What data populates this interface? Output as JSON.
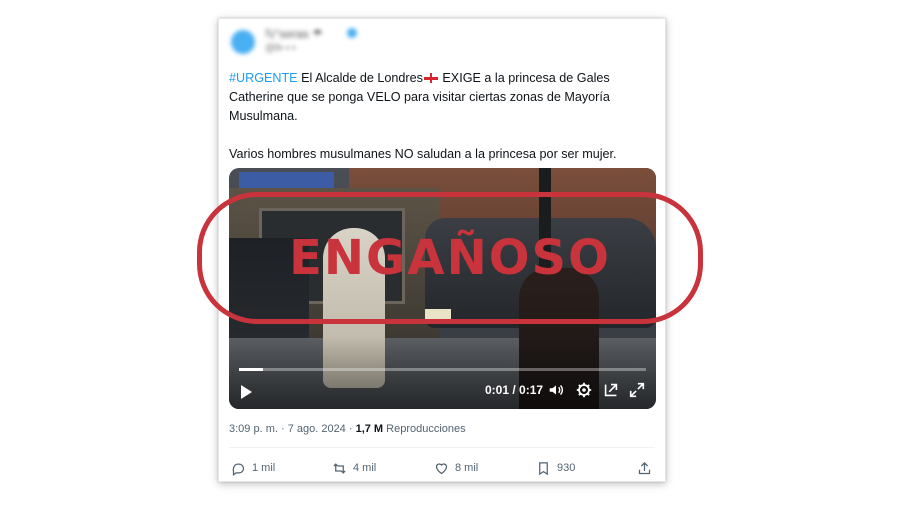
{
  "tweet": {
    "author_name": "ℕ°seras ☂",
    "author_handle": "@ll▪︎ ▪︎ ▪︎",
    "hashtag": "#URGENTE",
    "text_line1_rest": "El Alcalde de Londres",
    "text_line1_after_flag": "EXIGE a la princesa de Gales",
    "text_line2": "Catherine que se ponga VELO para visitar ciertas zonas de Mayoría",
    "text_line3": "Musulmana.",
    "text_paragraph2": "Varios hombres musulmanes NO saludan a la princesa por ser mujer.",
    "timestamp": "3:09 p. m. · 7 ago. 2024 · ",
    "views_count": "1,7 M",
    "views_label": " Reproducciones"
  },
  "video": {
    "time": "0:01 / 0:17",
    "progress": 0.06
  },
  "stamp": {
    "label": "ENGAÑOSO",
    "color": "#c9333b"
  },
  "actions": {
    "replies": "1 mil",
    "reposts": "4 mil",
    "likes": "8 mil",
    "bookmarks": "930"
  },
  "icons": [
    "reply-icon",
    "repost-icon",
    "like-icon",
    "bookmark-icon",
    "share-icon",
    "play-icon",
    "volume-icon",
    "settings-icon",
    "pip-icon",
    "fullscreen-icon"
  ]
}
